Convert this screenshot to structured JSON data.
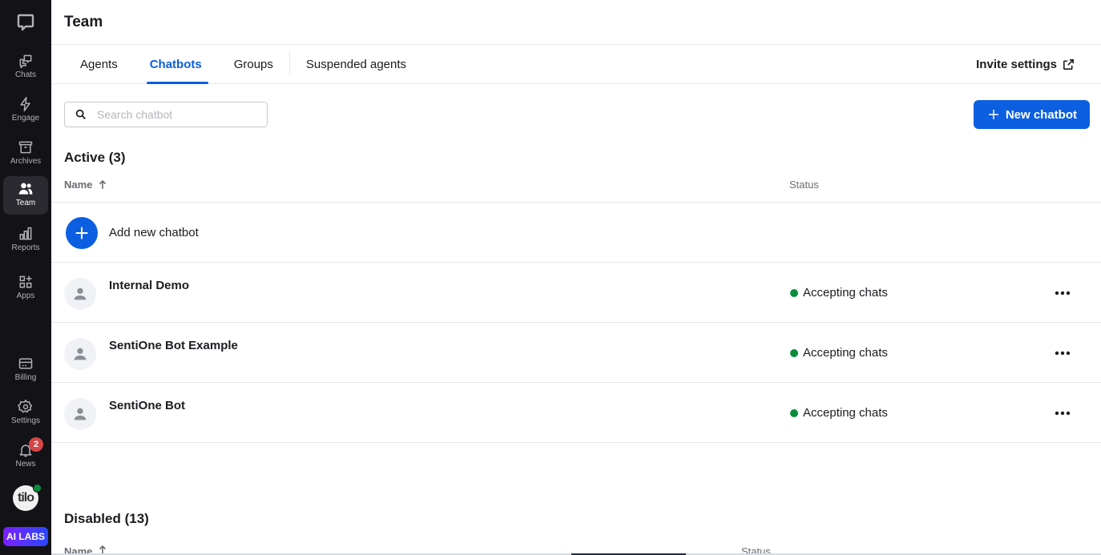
{
  "sidebar": {
    "logo": "chat-bubble-logo",
    "items": [
      {
        "label": "Chats",
        "icon": "chats-icon"
      },
      {
        "label": "Engage",
        "icon": "lightning-icon"
      },
      {
        "label": "Archives",
        "icon": "archive-icon"
      },
      {
        "label": "Team",
        "icon": "team-icon",
        "active": true
      },
      {
        "label": "Reports",
        "icon": "bar-chart-icon"
      },
      {
        "label": "Apps",
        "icon": "apps-icon"
      }
    ],
    "bottom_items": [
      {
        "label": "Billing",
        "icon": "credit-card-icon"
      },
      {
        "label": "Settings",
        "icon": "gear-icon"
      },
      {
        "label": "News",
        "icon": "bell-icon",
        "badge": "2"
      }
    ],
    "user_avatar_text": "tilo",
    "user_status": "online",
    "ai_labs_label": "AI LABS"
  },
  "header": {
    "title": "Team"
  },
  "tabs": [
    {
      "label": "Agents"
    },
    {
      "label": "Chatbots",
      "active": true
    },
    {
      "label": "Groups"
    },
    {
      "label": "Suspended agents"
    }
  ],
  "invite_settings_label": "Invite settings",
  "search": {
    "placeholder": "Search chatbot",
    "value": ""
  },
  "new_chatbot_label": "New chatbot",
  "active_section": {
    "title": "Active (3)",
    "columns": {
      "name": "Name",
      "status": "Status",
      "sort": "ascending"
    },
    "add_label": "Add new chatbot",
    "rows": [
      {
        "name": "Internal Demo",
        "status": "Accepting chats"
      },
      {
        "name": "SentiOne Bot Example",
        "status": "Accepting chats"
      },
      {
        "name": "SentiOne Bot",
        "status": "Accepting chats"
      }
    ]
  },
  "disabled_section": {
    "title": "Disabled (13)",
    "columns": {
      "name": "Name",
      "status": "Status"
    }
  },
  "colors": {
    "accent": "#0b5fe0",
    "sidebar_bg": "#131317",
    "status_green": "#0a8c3f",
    "badge_red": "#d64646"
  }
}
